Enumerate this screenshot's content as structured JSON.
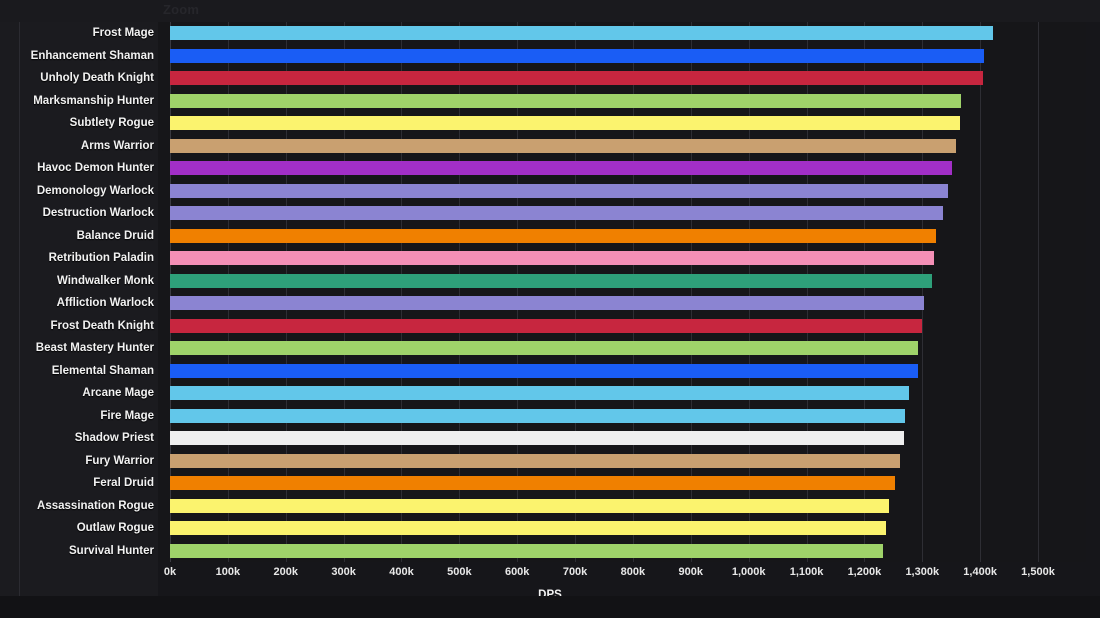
{
  "header": {
    "zoom_label": "Zoom"
  },
  "axis": {
    "x_title": "DPS",
    "ticks": [
      "0k",
      "100k",
      "200k",
      "300k",
      "400k",
      "500k",
      "600k",
      "700k",
      "800k",
      "900k",
      "1,000k",
      "1,100k",
      "1,200k",
      "1,300k",
      "1,400k",
      "1,500k"
    ]
  },
  "chart_data": {
    "type": "bar",
    "orientation": "horizontal",
    "title": "",
    "subtitle": "",
    "xlabel": "DPS",
    "ylabel": "",
    "xlim": [
      0,
      1500000
    ],
    "x_tick_step": 100000,
    "grid": true,
    "legend": "none",
    "categories": [
      "Frost Mage",
      "Enhancement Shaman",
      "Unholy Death Knight",
      "Marksmanship Hunter",
      "Subtlety Rogue",
      "Arms Warrior",
      "Havoc Demon Hunter",
      "Demonology Warlock",
      "Destruction Warlock",
      "Balance Druid",
      "Retribution Paladin",
      "Windwalker Monk",
      "Affliction Warlock",
      "Frost Death Knight",
      "Beast Mastery Hunter",
      "Elemental Shaman",
      "Arcane Mage",
      "Fire Mage",
      "Shadow Priest",
      "Fury Warrior",
      "Feral Druid",
      "Assassination Rogue",
      "Outlaw Rogue",
      "Survival Hunter"
    ],
    "values": [
      1423000,
      1407000,
      1405000,
      1367000,
      1365000,
      1358000,
      1352000,
      1345000,
      1335000,
      1323000,
      1320000,
      1317000,
      1303000,
      1300000,
      1292000,
      1292000,
      1277000,
      1270000,
      1268000,
      1262000,
      1253000,
      1242000,
      1237000,
      1233000
    ],
    "colors": [
      "#62c7ea",
      "#1a5df5",
      "#c7263f",
      "#9fd36a",
      "#fbf36e",
      "#c9a070",
      "#a22fc7",
      "#8b84d2",
      "#8b84d2",
      "#f08000",
      "#f48fb6",
      "#2ea07a",
      "#8b84d2",
      "#c7263f",
      "#9fd36a",
      "#1a5df5",
      "#62c7ea",
      "#62c7ea",
      "#efefef",
      "#c9a070",
      "#f08000",
      "#fbf36e",
      "#fbf36e",
      "#9fd36a"
    ]
  }
}
